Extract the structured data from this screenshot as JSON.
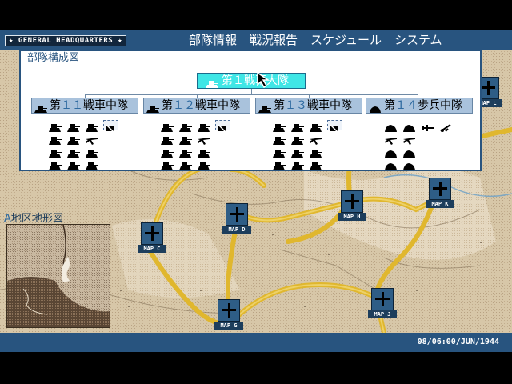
{
  "header": {
    "hq_label": "★ GENERAL HEADQUARTERS ★",
    "menu": [
      "部隊情報",
      "戦況報告",
      "スケジュール",
      "システム"
    ]
  },
  "status": {
    "datetime": "08/06:00/JUN/1944"
  },
  "map": {
    "markers": [
      {
        "label": "MAP C"
      },
      {
        "label": "MAP D"
      },
      {
        "label": "MAP H"
      },
      {
        "label": "MAP K"
      },
      {
        "label": "MAP G"
      },
      {
        "label": "MAP J"
      },
      {
        "label": "MAP L"
      }
    ]
  },
  "terrain": {
    "prefix": "A",
    "title": "地区地形図"
  },
  "org_chart": {
    "title": "部隊構成図",
    "battalion": {
      "label": "第１戦車大隊",
      "icon": "tank-unit-icon"
    },
    "companies": [
      {
        "prefix": "第",
        "num": "１１",
        "suffix": "戦車中隊",
        "icon": "tank-unit-icon",
        "units": [
          "tank",
          "tank",
          "tank",
          "supply-crossed",
          "tank",
          "tank",
          "artillery",
          "tank",
          "tank",
          "tank",
          "tank",
          "tank",
          "tank"
        ]
      },
      {
        "prefix": "第",
        "num": "１２",
        "suffix": "戦車中隊",
        "icon": "tank-unit-icon",
        "units": [
          "tank",
          "tank",
          "tank",
          "supply-crossed",
          "tank",
          "tank",
          "artillery",
          "tank",
          "tank",
          "tank",
          "tank",
          "tank",
          "tank"
        ]
      },
      {
        "prefix": "第",
        "num": "１３",
        "suffix": "戦車中隊",
        "icon": "tank-unit-icon",
        "units": [
          "tank",
          "tank",
          "tank",
          "supply-crossed",
          "tank",
          "tank",
          "artillery",
          "tank",
          "tank",
          "tank",
          "tank",
          "tank",
          "tank"
        ]
      },
      {
        "prefix": "第",
        "num": "１４",
        "suffix": "歩兵中隊",
        "icon": "infantry-unit-icon",
        "units": [
          "infantry",
          "infantry",
          "aircraft",
          "anti-tank",
          "artillery",
          "artillery",
          "infantry",
          "infantry",
          "infantry",
          "infantry"
        ]
      }
    ]
  },
  "colors": {
    "bar": "#28547f",
    "map_base": "#d7c7a8",
    "road": "#e0b72e",
    "selected": "#3fe6e6",
    "company": "#a9c2dc"
  }
}
